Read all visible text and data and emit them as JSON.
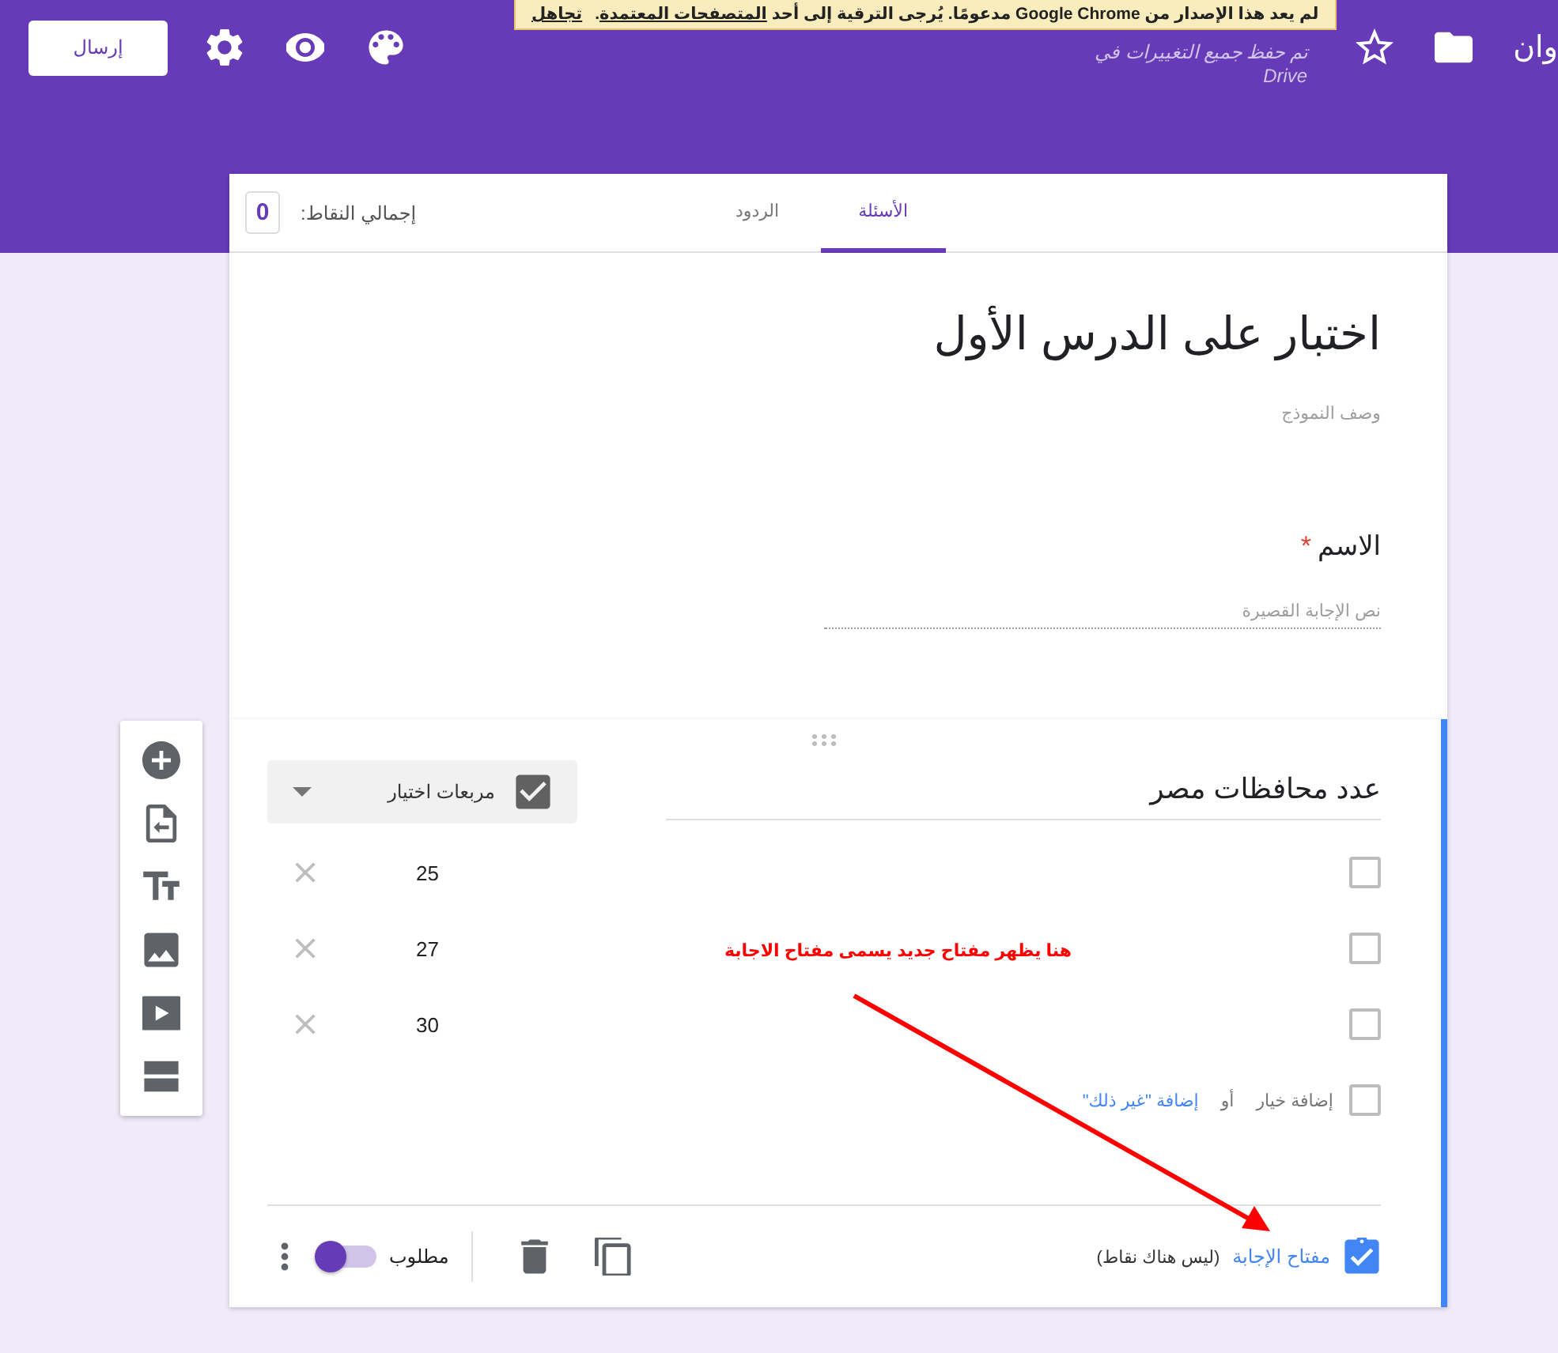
{
  "header": {
    "title": "وان",
    "saved_status": "تم حفظ جميع التغييرات في",
    "saved_location": "Drive",
    "send_button": "إرسال"
  },
  "notice": {
    "message_before": "لم يعد هذا الإصدار من Google Chrome مدعومًا. يُرجى الترقية إلى أحد",
    "link": "المتصفحات المعتمدة",
    "message_after": ".",
    "dismiss": "تجاهل"
  },
  "tabs": [
    {
      "label": "الأسئلة",
      "selected": true
    },
    {
      "label": "الردود",
      "selected": false
    }
  ],
  "points": {
    "label": "إجمالي النقاط:",
    "value": "0"
  },
  "form": {
    "title": "اختبار على الدرس الأول",
    "description_placeholder": "وصف النموذج"
  },
  "name_question": {
    "title": "الاسم",
    "required_mark": "*",
    "answer_placeholder": "نص الإجابة القصيرة"
  },
  "question": {
    "title": "عدد محافظات مصر",
    "type": "مربعات اختيار",
    "options": [
      {
        "label": "25",
        "checked": false
      },
      {
        "label": "27",
        "checked": false
      },
      {
        "label": "30",
        "checked": false
      }
    ],
    "add_option_checked": false,
    "add_option": "إضافة خيار",
    "or": "أو",
    "add_other": "إضافة \"غير ذلك\"",
    "answer_key": "مفتاح الإجابة",
    "points_note": "(ليس هناك نقاط)",
    "required_label": "مطلوب",
    "required": true
  },
  "annotation": {
    "text": "هنا  يظهر مفتاح جديد يسمى مفتاح الاجابة"
  }
}
